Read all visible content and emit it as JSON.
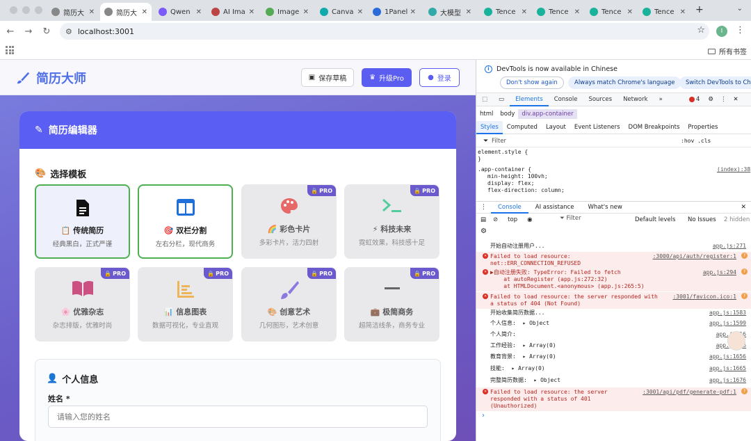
{
  "browser": {
    "tabs": [
      {
        "title": "简历大",
        "active": false
      },
      {
        "title": "简历大",
        "active": true
      },
      {
        "title": "Qwen",
        "active": false
      },
      {
        "title": "AI Ima",
        "active": false
      },
      {
        "title": "Image",
        "active": false
      },
      {
        "title": "Canva",
        "active": false
      },
      {
        "title": "1Panel",
        "active": false
      },
      {
        "title": "大模型",
        "active": false
      },
      {
        "title": "Tence",
        "active": false
      },
      {
        "title": "Tence",
        "active": false
      },
      {
        "title": "Tence",
        "active": false
      },
      {
        "title": "Tence",
        "active": false
      }
    ],
    "url": "localhost:3001",
    "profile_initial": "I",
    "bookmarks_label": "所有书签"
  },
  "app": {
    "logo_text": "简历大师",
    "buttons": {
      "save": "保存草稿",
      "pro": "升级Pro",
      "login": "登录"
    },
    "editor_title": "简历编辑器",
    "template_section_title": "选择模板",
    "pro_badge": "PRO",
    "templates": [
      {
        "name": "📋 传统简历",
        "desc": "经典黑白，正式严谨",
        "icon": "document-icon",
        "color": "#111111",
        "pro": false,
        "selected": true
      },
      {
        "name": "🎯 双栏分割",
        "desc": "左右分栏，现代商务",
        "icon": "columns-icon",
        "color": "#1e6fd9",
        "pro": false,
        "selected": true
      },
      {
        "name": "🌈 彩色卡片",
        "desc": "多彩卡片，活力四射",
        "icon": "palette-icon",
        "color": "#e53935",
        "pro": true,
        "selected": false
      },
      {
        "name": "⚡ 科技未来",
        "desc": "霓虹效果，科技感十足",
        "icon": "terminal-icon",
        "color": "#19c37d",
        "pro": true,
        "selected": false
      },
      {
        "name": "🌸 优雅杂志",
        "desc": "杂志排版，优雅时尚",
        "icon": "book-icon",
        "color": "#c2185b",
        "pro": true,
        "selected": false
      },
      {
        "name": "📊 信息图表",
        "desc": "数据可视化，专业直观",
        "icon": "chart-icon",
        "color": "#f0a020",
        "pro": true,
        "selected": false
      },
      {
        "name": "🎨 创意艺术",
        "desc": "几何图形，艺术创意",
        "icon": "brush-icon",
        "color": "#6a4ddb",
        "pro": true,
        "selected": false
      },
      {
        "name": "💼 极简商务",
        "desc": "超简洁线条，商务专业",
        "icon": "minus-icon",
        "color": "#333333",
        "pro": true,
        "selected": false
      }
    ],
    "personal": {
      "title": "个人信息",
      "name_label": "姓名 *",
      "name_placeholder": "请输入您的姓名"
    }
  },
  "devtools": {
    "banner_text": "DevTools is now available in Chinese",
    "banner_buttons": [
      "Don't show again",
      "Always match Chrome's language",
      "Switch DevTools to Chi"
    ],
    "tabs": [
      "Elements",
      "Console",
      "Sources",
      "Network"
    ],
    "error_count": "4",
    "breadcrumbs": [
      "html",
      "body",
      "div.app-container"
    ],
    "style_tabs": [
      "Styles",
      "Computed",
      "Layout",
      "Event Listeners",
      "DOM Breakpoints",
      "Properties"
    ],
    "filter_placeholder": "Filter",
    "filter_right": ":hov .cls",
    "styles_code": {
      "element_style_open": "element.style {",
      "close": "}",
      "rule_selector": ".app-container {",
      "rule_source": "(index):38",
      "prop1": "min-height: 100vh;",
      "prop2": "display: flex;",
      "prop3": "flex-direction: column;"
    },
    "console_tabs": [
      "Console",
      "AI assistance",
      "What's new"
    ],
    "console_context": "top",
    "console_filter": "Filter",
    "log_levels": "Default levels",
    "issues": "No Issues",
    "hidden": "2 hidden",
    "logs": [
      {
        "type": "log",
        "text": "开始自动注册用户...",
        "src": "app.js:271"
      },
      {
        "type": "error",
        "text": "Failed to load resource:\nnet::ERR_CONNECTION_REFUSED",
        "src": ":3000/api/auth/register:1"
      },
      {
        "type": "error",
        "text": "▶自动注册失败: TypeError: Failed to fetch\n    at autoRegister (app.js:272:32)\n    at HTMLDocument.<anonymous> (app.js:265:5)",
        "src": "app.js:294"
      },
      {
        "type": "error",
        "text": "Failed to load resource: the server responded with\na status of 404 (Not Found)",
        "src": ":3001/favicon.ico:1"
      },
      {
        "type": "log",
        "text": "开始收集简历数据...",
        "src": "app.js:1583"
      },
      {
        "type": "log",
        "text": "个人信息:  ▸ Object",
        "src": "app.js:1599"
      },
      {
        "type": "log",
        "text": "个人简介:",
        "src": "app.js:16"
      },
      {
        "type": "log",
        "text": "工作经验:  ▸ Array(0)",
        "src": "app.js:16"
      },
      {
        "type": "log",
        "text": "教育背景:  ▸ Array(0)",
        "src": "app.js:1656"
      },
      {
        "type": "log",
        "text": "技能:  ▸ Array(0)",
        "src": "app.js:1665"
      },
      {
        "type": "log",
        "text": "完整简历数据:  ▸ Object",
        "src": "app.js:1676"
      },
      {
        "type": "error",
        "text": "Failed to load resource: the server\nresponded with a status of 401\n(Unauthorized)",
        "src": ":3001/api/pdf/generate-pdf:1"
      }
    ],
    "prompt": "›"
  }
}
